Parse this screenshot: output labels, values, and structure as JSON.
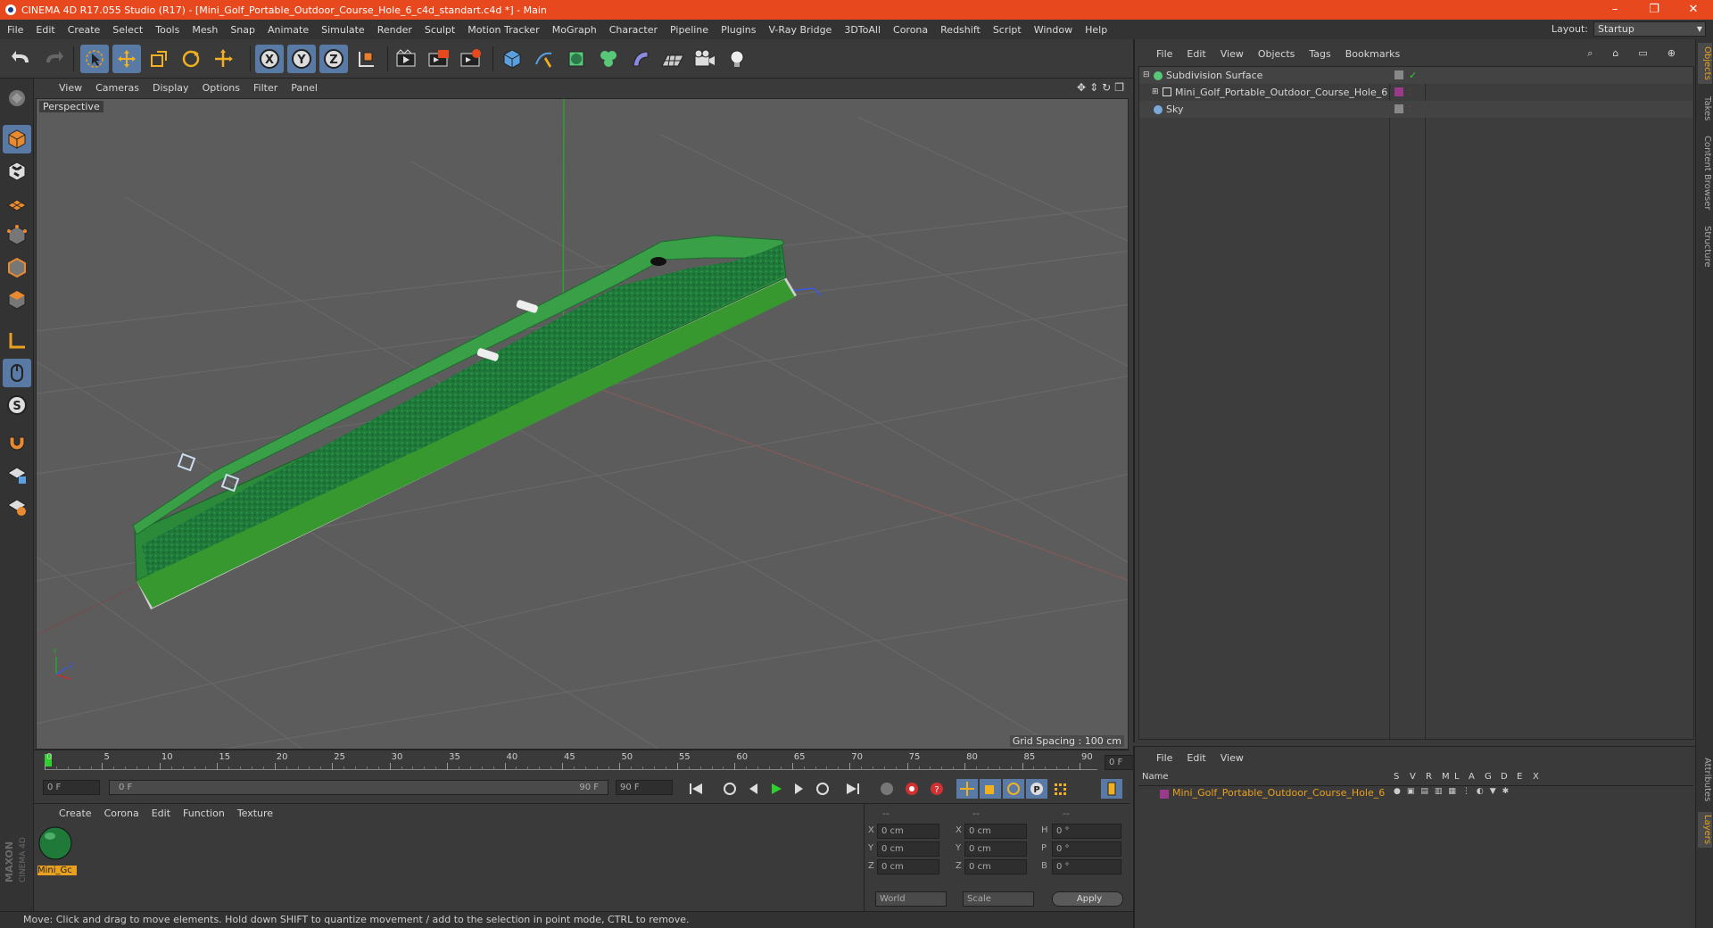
{
  "window": {
    "title": "CINEMA 4D R17.055 Studio (R17) - [Mini_Golf_Portable_Outdoor_Course_Hole_6_c4d_standart.c4d *] - Main",
    "controls": [
      "–",
      "❐",
      "✕"
    ]
  },
  "menubar": {
    "items": [
      "File",
      "Edit",
      "Create",
      "Select",
      "Tools",
      "Mesh",
      "Snap",
      "Animate",
      "Simulate",
      "Render",
      "Sculpt",
      "Motion Tracker",
      "MoGraph",
      "Character",
      "Pipeline",
      "Plugins",
      "V-Ray Bridge",
      "3DToAll",
      "Corona",
      "Redshift",
      "Script",
      "Window",
      "Help"
    ],
    "layout_label": "Layout:",
    "layout_value": "Startup"
  },
  "viewport": {
    "menu": [
      "View",
      "Cameras",
      "Display",
      "Options",
      "Filter",
      "Panel"
    ],
    "label": "Perspective",
    "grid_spacing": "Grid Spacing : 100 cm"
  },
  "timeline": {
    "ticks": [
      "0",
      "5",
      "10",
      "15",
      "20",
      "25",
      "30",
      "35",
      "40",
      "45",
      "50",
      "55",
      "60",
      "65",
      "70",
      "75",
      "80",
      "85",
      "90"
    ],
    "current_frame_box": "0 F",
    "start_field": "0 F",
    "slider_start": "0 F",
    "slider_end": "90 F",
    "end_field": "90 F"
  },
  "material_panel": {
    "menu": [
      "Create",
      "Corona",
      "Edit",
      "Function",
      "Texture"
    ],
    "material_name": "Mini_Gc"
  },
  "coord_panel": {
    "header": [
      "--",
      "--",
      "--"
    ],
    "rows": [
      {
        "a": "X",
        "av": "0 cm",
        "b": "X",
        "bv": "0 cm",
        "c": "H",
        "cv": "0 °"
      },
      {
        "a": "Y",
        "av": "0 cm",
        "b": "Y",
        "bv": "0 cm",
        "c": "P",
        "cv": "0 °"
      },
      {
        "a": "Z",
        "av": "0 cm",
        "b": "Z",
        "bv": "0 cm",
        "c": "B",
        "cv": "0 °"
      }
    ],
    "world": "World",
    "scale": "Scale",
    "apply": "Apply"
  },
  "objects_panel": {
    "menu": [
      "File",
      "Edit",
      "View",
      "Objects",
      "Tags",
      "Bookmarks"
    ],
    "items": [
      {
        "name": "Subdivision Surface",
        "color": "#58c878"
      },
      {
        "name": "Mini_Golf_Portable_Outdoor_Course_Hole_6",
        "color": "#9a3a8a"
      },
      {
        "name": "Sky",
        "color": "#7aa8d8"
      }
    ]
  },
  "layers_panel": {
    "menu": [
      "File",
      "Edit",
      "View"
    ],
    "columns": [
      "Name",
      "S",
      "V",
      "R",
      "M",
      "L",
      "A",
      "G",
      "D",
      "E",
      "X"
    ],
    "row_name": "Mini_Golf_Portable_Outdoor_Course_Hole_6"
  },
  "side_tabs": [
    "Objects",
    "Takes",
    "Content Browser",
    "Structure",
    "Attributes",
    "Layers"
  ],
  "status": "Move: Click and drag to move elements. Hold down SHIFT to quantize movement / add to the selection in point mode, CTRL to remove.",
  "brand": "MAXON CINEMA 4D",
  "colors": {
    "accent": "#e8481e",
    "selection": "#5a7aa6",
    "highlight": "#e8a020"
  }
}
